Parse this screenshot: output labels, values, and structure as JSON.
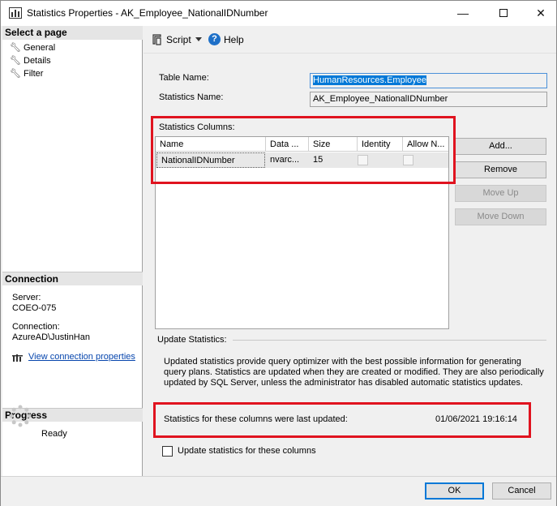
{
  "window": {
    "title": "Statistics Properties - AK_Employee_NationalIDNumber",
    "controls": {
      "minimize": "—",
      "close": "✕"
    }
  },
  "left_panel": {
    "select_page_header": "Select a page",
    "pages": [
      {
        "label": "General",
        "icon": "wrench-icon"
      },
      {
        "label": "Details",
        "icon": "wrench-icon"
      },
      {
        "label": "Filter",
        "icon": "wrench-icon"
      }
    ],
    "connection_header": "Connection",
    "server_label": "Server:",
    "server_value": "COEO-075",
    "connection_label": "Connection:",
    "connection_value": "AzureAD\\JustinHan",
    "view_connection_link": "View connection properties",
    "progress_header": "Progress",
    "progress_status": "Ready"
  },
  "toolbar": {
    "script_label": "Script",
    "help_label": "Help"
  },
  "form": {
    "table_name_label": "Table Name:",
    "table_name_value": "HumanResources.Employee",
    "statistics_name_label": "Statistics Name:",
    "statistics_name_value": "AK_Employee_NationalIDNumber",
    "statistics_columns_label": "Statistics Columns:",
    "columns_headers": [
      "Name",
      "Data ...",
      "Size",
      "Identity",
      "Allow N..."
    ],
    "columns_rows": [
      {
        "name": "NationalIDNumber",
        "data_type": "nvarc...",
        "size": "15",
        "identity": false,
        "allow_nulls": false
      }
    ],
    "buttons": {
      "add": "Add...",
      "remove": "Remove",
      "move_up": "Move Up",
      "move_down": "Move Down"
    },
    "update_statistics_label": "Update Statistics:",
    "update_description": "Updated statistics provide query optimizer with the best possible information for generating query plans. Statistics are updated when they are created or modified. They are also periodically updated by SQL Server, unless the administrator has disabled automatic statistics updates.",
    "last_updated_label": "Statistics for these columns were last updated:",
    "last_updated_value": "01/06/2021 19:16:14",
    "update_checkbox_label": "Update statistics for these columns",
    "update_checkbox_checked": false
  },
  "footer": {
    "ok_label": "OK",
    "cancel_label": "Cancel"
  },
  "colors": {
    "highlight_red": "#e0131f",
    "selection_blue": "#0078d7",
    "link_blue": "#0645ad"
  }
}
